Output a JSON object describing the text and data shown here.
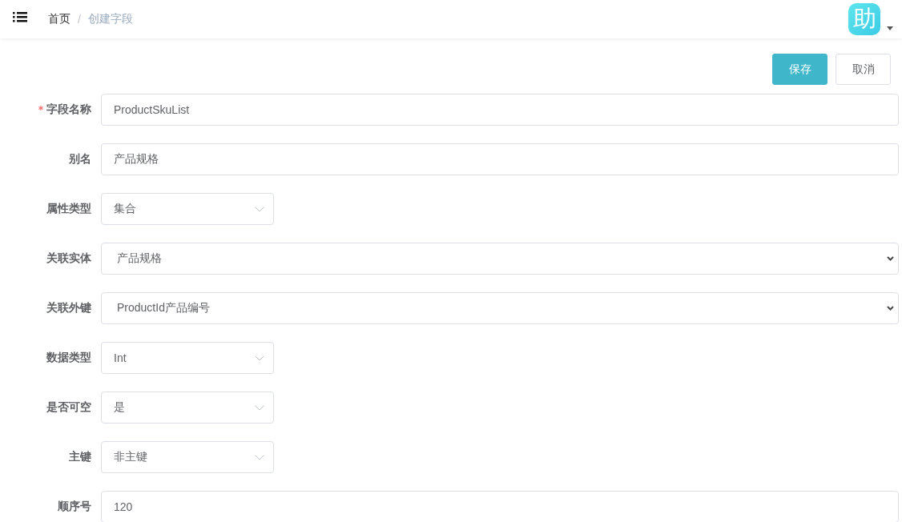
{
  "header": {
    "breadcrumb": [
      {
        "label": "首页",
        "current": false
      },
      {
        "label": "创建字段",
        "current": true
      }
    ],
    "separator": "/",
    "avatar": {
      "text": "助"
    }
  },
  "actions": [
    {
      "label": "保存",
      "kind": "primary"
    },
    {
      "label": "取消",
      "kind": "default"
    }
  ],
  "fields": [
    {
      "label": "字段名称",
      "required": true,
      "kind": "input",
      "value": "ProductSkuList"
    },
    {
      "label": "别名",
      "required": false,
      "kind": "input",
      "value": "产品规格"
    },
    {
      "label": "属性类型",
      "required": false,
      "kind": "dropdown",
      "value": "集合"
    },
    {
      "label": "关联实体",
      "required": false,
      "kind": "native-select",
      "value": "产品规格"
    },
    {
      "label": "关联外键",
      "required": false,
      "kind": "native-select",
      "value": "ProductId产品编号"
    },
    {
      "label": "数据类型",
      "required": false,
      "kind": "dropdown",
      "value": "Int"
    },
    {
      "label": "是否可空",
      "required": false,
      "kind": "dropdown",
      "value": "是"
    },
    {
      "label": "主键",
      "required": false,
      "kind": "dropdown",
      "value": "非主键"
    },
    {
      "label": "顺序号",
      "required": false,
      "kind": "input",
      "value": "120"
    }
  ]
}
